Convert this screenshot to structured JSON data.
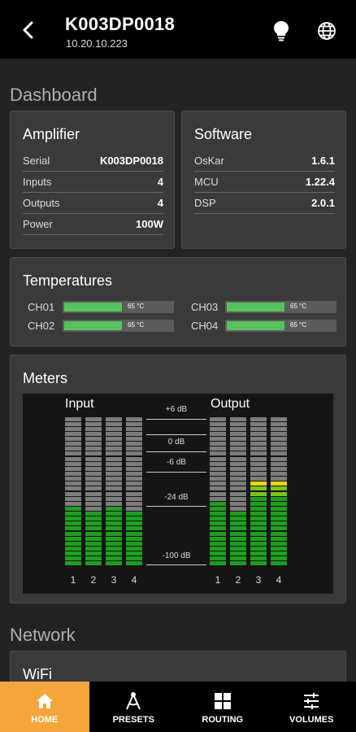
{
  "header": {
    "title": "K003DP0018",
    "ip": "10.20.10.223"
  },
  "dashboard": {
    "heading": "Dashboard",
    "amplifier": {
      "title": "Amplifier",
      "rows": [
        {
          "key": "Serial",
          "value": "K003DP0018"
        },
        {
          "key": "Inputs",
          "value": "4"
        },
        {
          "key": "Outputs",
          "value": "4"
        },
        {
          "key": "Power",
          "value": "100W"
        }
      ]
    },
    "software": {
      "title": "Software",
      "rows": [
        {
          "key": "OsKar",
          "value": "1.6.1"
        },
        {
          "key": "MCU",
          "value": "1.22.4"
        },
        {
          "key": "DSP",
          "value": "2.0.1"
        }
      ]
    },
    "temperatures": {
      "title": "Temperatures",
      "channels": [
        {
          "name": "CH01",
          "value": "65 °C",
          "level": 0.52
        },
        {
          "name": "CH03",
          "value": "65 °C",
          "level": 0.52
        },
        {
          "name": "CH02",
          "value": "65 °C",
          "level": 0.52
        },
        {
          "name": "CH04",
          "value": "65 °C",
          "level": 0.52
        }
      ]
    },
    "meters": {
      "title": "Meters",
      "input_label": "Input",
      "output_label": "Output",
      "scale": [
        "+6 dB",
        "0 dB",
        "-6 dB",
        "-24 dB",
        "-100 dB"
      ],
      "inputs": [
        {
          "channel": "1",
          "level": 0.41
        },
        {
          "channel": "2",
          "level": 0.37
        },
        {
          "channel": "3",
          "level": 0.39
        },
        {
          "channel": "4",
          "level": 0.35
        }
      ],
      "outputs": [
        {
          "channel": "1",
          "level": 0.42
        },
        {
          "channel": "2",
          "level": 0.38
        },
        {
          "channel": "3",
          "level": 0.58
        },
        {
          "channel": "4",
          "level": 0.55
        }
      ]
    }
  },
  "network": {
    "heading": "Network",
    "wifi_title": "WiFi"
  },
  "nav": [
    {
      "label": "HOME",
      "icon": "home-icon",
      "active": true
    },
    {
      "label": "PRESETS",
      "icon": "compass-icon",
      "active": false
    },
    {
      "label": "ROUTING",
      "icon": "grid-icon",
      "active": false
    },
    {
      "label": "VOLUMES",
      "icon": "sliders-icon",
      "active": false
    }
  ],
  "colors": {
    "accent": "#f4a63c",
    "meter_green": "#1f9e1f",
    "meter_yellow": "#e6d800",
    "temp_green": "#56c25e"
  }
}
